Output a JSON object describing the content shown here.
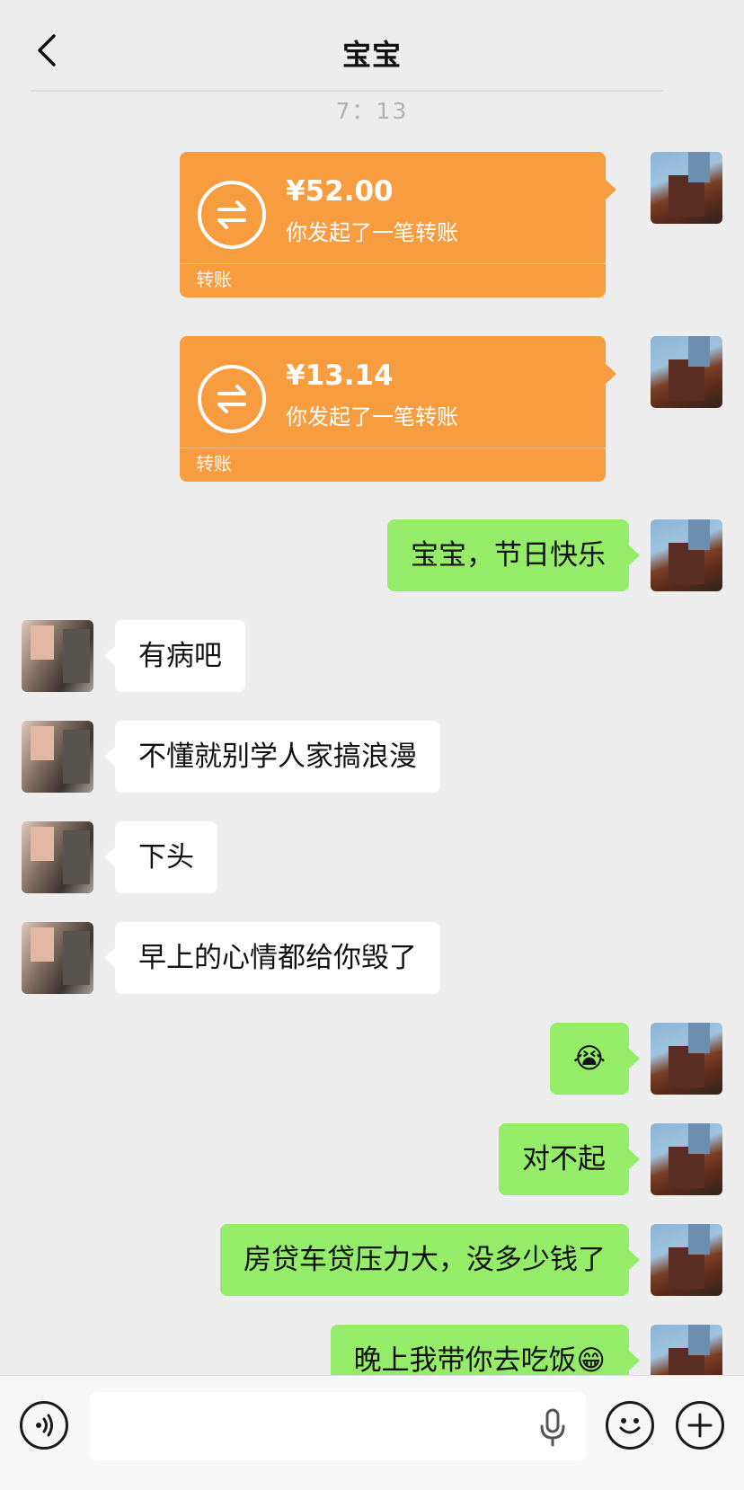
{
  "header": {
    "title": "宝宝",
    "back_icon": "chevron-left-icon"
  },
  "timestamp": "7：13",
  "transfers": [
    {
      "amount": "¥52.00",
      "desc": "你发起了一笔转账",
      "label": "转账"
    },
    {
      "amount": "¥13.14",
      "desc": "你发起了一笔转账",
      "label": "转账"
    }
  ],
  "messages": [
    {
      "side": "right",
      "text": "宝宝，节日快乐"
    },
    {
      "side": "left",
      "text": "有病吧"
    },
    {
      "side": "left",
      "text": "不懂就别学人家搞浪漫"
    },
    {
      "side": "left",
      "text": "下头"
    },
    {
      "side": "left",
      "text": "早上的心情都给你毁了"
    },
    {
      "side": "right",
      "text": "😭"
    },
    {
      "side": "right",
      "text": "对不起"
    },
    {
      "side": "right",
      "text": "房贷车贷压力大，没多少钱了"
    },
    {
      "side": "right",
      "text": "晚上我带你去吃饭😁"
    }
  ],
  "input_bar": {
    "voice_icon": "voice-icon",
    "mic_icon": "microphone-icon",
    "emoji_icon": "smiley-icon",
    "plus_icon": "plus-icon",
    "value": ""
  },
  "colors": {
    "background": "#ededed",
    "sent": "#95ec69",
    "received": "#ffffff",
    "transfer": "#f79c3f"
  }
}
